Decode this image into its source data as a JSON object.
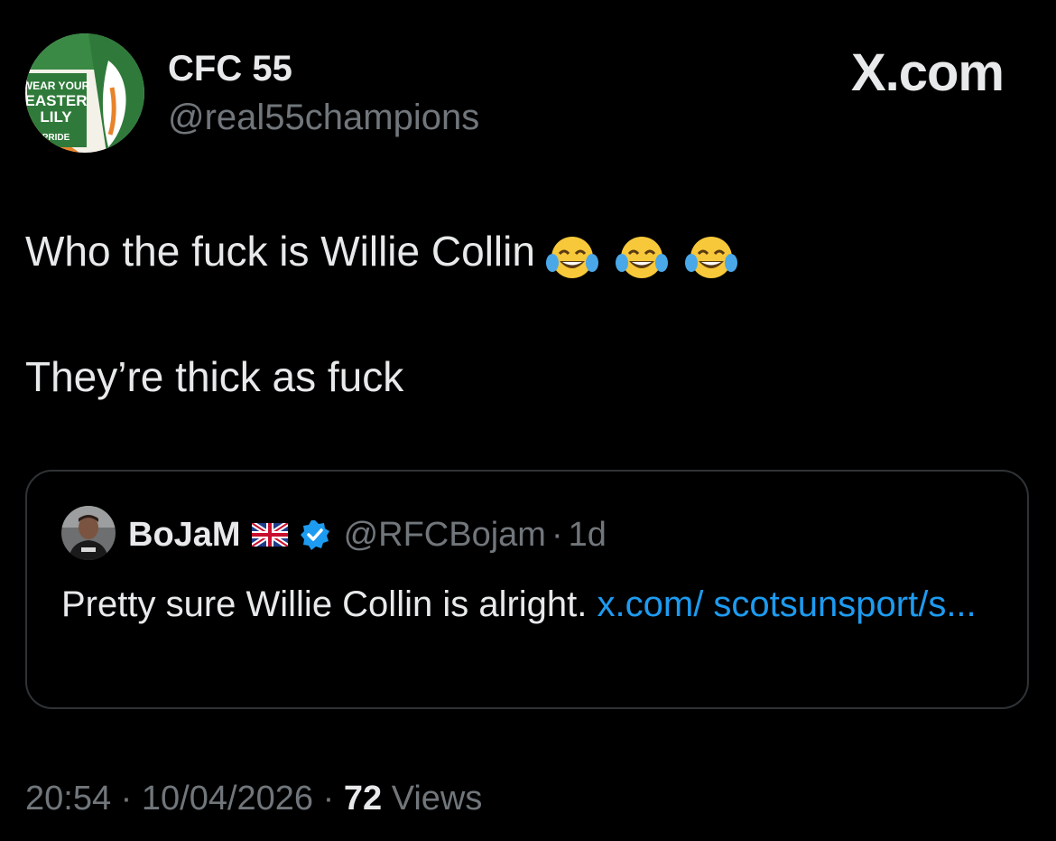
{
  "author": {
    "display_name": "CFC 55",
    "handle": "@real55champions",
    "avatar_text": [
      "WEAR YOUR",
      "EASTER",
      "LILY",
      "PRIDE"
    ]
  },
  "site_logo": "X.com",
  "tweet": {
    "line1": "Who the fuck is Willie Collin",
    "line1_emoji": [
      "face-with-tears-of-joy",
      "face-with-tears-of-joy",
      "face-with-tears-of-joy"
    ],
    "line2": "They’re thick as fuck"
  },
  "quoted_tweet": {
    "display_name": "BoJaM",
    "flag_icon": "uk-flag-icon",
    "verified_icon": "verified-badge-icon",
    "handle": "@RFCBojam",
    "separator": "·",
    "time_ago": "1d",
    "text": "Pretty sure Willie Collin is alright.",
    "link_text": "x.com/ scotsunsport/s..."
  },
  "meta": {
    "time": "20:54",
    "separator": "·",
    "date": "10/04/2026",
    "views_count": "72",
    "views_label": "Views"
  },
  "colors": {
    "background": "#000000",
    "text_primary": "#e7e9ea",
    "text_secondary": "#71767b",
    "link": "#1d9bf0",
    "border": "#2f3336",
    "verified": "#1d9bf0"
  }
}
